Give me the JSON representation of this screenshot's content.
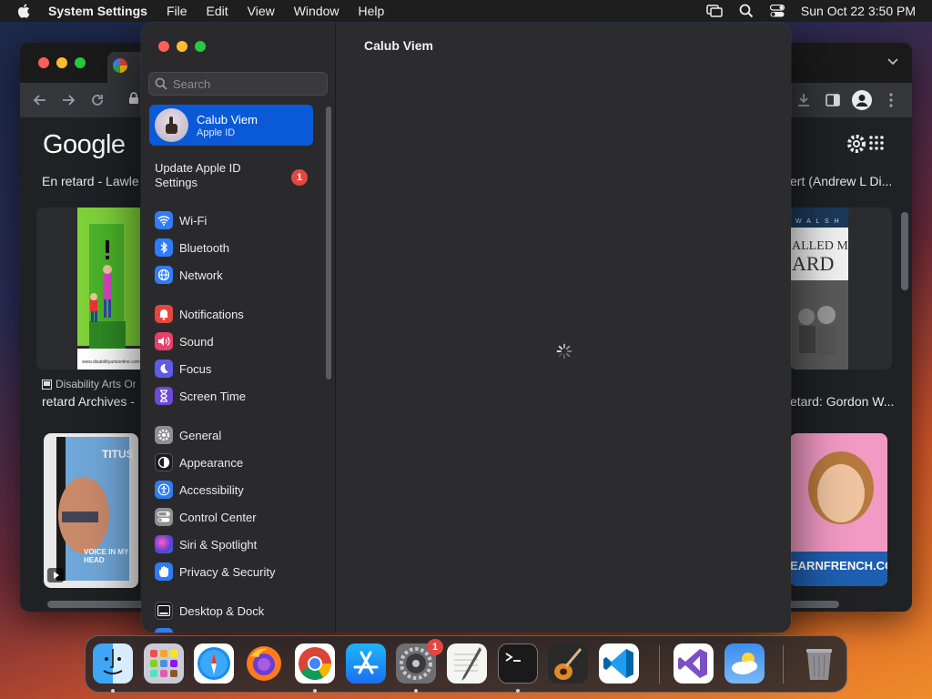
{
  "menubar": {
    "app_name": "System Settings",
    "items": [
      "File",
      "Edit",
      "View",
      "Window",
      "Help"
    ],
    "datetime": "Sun Oct 22  3:50 PM"
  },
  "browser": {
    "logo": "Google",
    "results": {
      "left_title_1": "En retard - Lawle",
      "right_title_1": "ert (Andrew L Di...",
      "left_source_2": "Disability Arts Or",
      "left_title_2": "retard Archives -",
      "right_title_2": "etard: Gordon W...",
      "right_image_caption": "EARNFRENCH.COM",
      "right_book_text_1": "ALLED ME",
      "right_book_text_2": "ARD",
      "left_dvd_title": "TITUS",
      "left_dvd_sub": "VOICE IN MY HEAD",
      "right_book_header": "W A L S H",
      "left_image_footer": "www.disabilityartsonline.com"
    }
  },
  "settings": {
    "search_placeholder": "Search",
    "account": {
      "name": "Calub Viem",
      "subtitle": "Apple ID"
    },
    "update": {
      "label": "Update Apple ID Settings",
      "badge": "1"
    },
    "content_title": "Calub Viem",
    "sidebar_items": [
      {
        "label": "Wi-Fi",
        "icon": "wifi-icon",
        "color": "#2f7cf6"
      },
      {
        "label": "Bluetooth",
        "icon": "bluetooth-icon",
        "color": "#2f7cf6"
      },
      {
        "label": "Network",
        "icon": "globe-icon",
        "color": "#2f7cf6"
      },
      {
        "label": "Notifications",
        "icon": "bell-icon",
        "color": "#e5473f"
      },
      {
        "label": "Sound",
        "icon": "speaker-icon",
        "color": "#e5416b"
      },
      {
        "label": "Focus",
        "icon": "moon-icon",
        "color": "#5e5ce6"
      },
      {
        "label": "Screen Time",
        "icon": "hourglass-icon",
        "color": "#6e4ad8"
      },
      {
        "label": "General",
        "icon": "gear-icon",
        "color": "#8e8e93"
      },
      {
        "label": "Appearance",
        "icon": "appearance-icon",
        "color": "#1c1c1e"
      },
      {
        "label": "Accessibility",
        "icon": "accessibility-icon",
        "color": "#2f7cf6"
      },
      {
        "label": "Control Center",
        "icon": "control-center-icon",
        "color": "#8e8e93"
      },
      {
        "label": "Siri & Spotlight",
        "icon": "siri-icon",
        "color": "#7b3fd4"
      },
      {
        "label": "Privacy & Security",
        "icon": "hand-icon",
        "color": "#2f7cf6"
      },
      {
        "label": "Desktop & Dock",
        "icon": "dock-icon",
        "color": "#1c1c1e"
      }
    ]
  },
  "dock": {
    "apps": [
      {
        "name": "Finder",
        "icon": "finder-icon",
        "running": true
      },
      {
        "name": "Launchpad",
        "icon": "launchpad-icon",
        "running": false
      },
      {
        "name": "Safari",
        "icon": "safari-icon",
        "running": false
      },
      {
        "name": "Firefox",
        "icon": "firefox-icon",
        "running": false
      },
      {
        "name": "Google Chrome",
        "icon": "chrome-icon",
        "running": true
      },
      {
        "name": "App Store",
        "icon": "app-store-icon",
        "running": false
      },
      {
        "name": "System Settings",
        "icon": "system-settings-icon",
        "running": true,
        "badge": "1"
      },
      {
        "name": "TextEdit",
        "icon": "textedit-icon",
        "running": false
      },
      {
        "name": "Terminal",
        "icon": "terminal-icon",
        "running": true
      },
      {
        "name": "GarageBand",
        "icon": "garageband-icon",
        "running": false
      },
      {
        "name": "Visual Studio Code",
        "icon": "vscode-icon",
        "running": false
      },
      {
        "name": "Visual Studio",
        "icon": "visual-studio-icon",
        "running": false
      },
      {
        "name": "Weather",
        "icon": "weather-icon",
        "running": false
      },
      {
        "name": "Trash",
        "icon": "trash-icon",
        "running": false
      }
    ]
  }
}
